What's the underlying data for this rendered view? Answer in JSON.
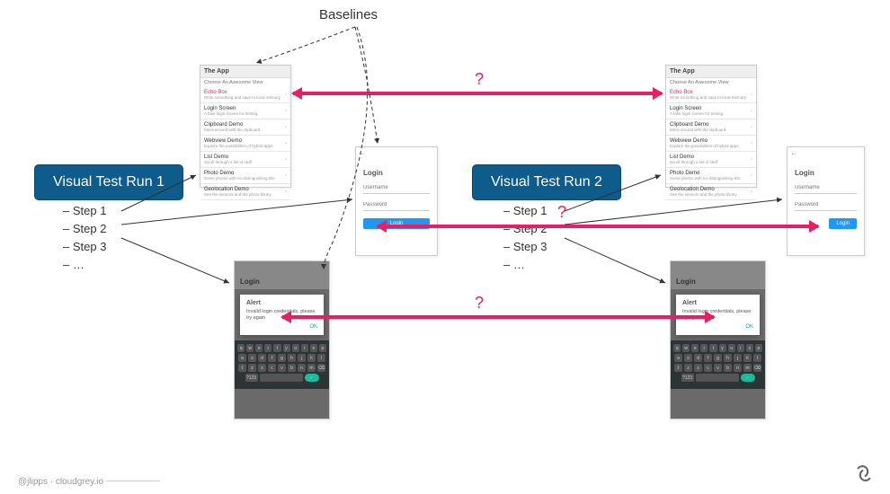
{
  "labels": {
    "baselines": "Baselines"
  },
  "runs": {
    "run1": {
      "title": "Visual Test Run 1",
      "steps": [
        "Step 1",
        "Step 2",
        "Step 3",
        "…"
      ]
    },
    "run2": {
      "title": "Visual Test Run 2",
      "steps": [
        "Step 1",
        "Step 2",
        "Step 3",
        "…"
      ]
    }
  },
  "list_screen": {
    "title": "The App",
    "subtitle": "Choose An Awesome View",
    "items": [
      {
        "title": "Echo Box",
        "desc": "Write something and save to local memory"
      },
      {
        "title": "Login Screen",
        "desc": "A fake login screen for testing"
      },
      {
        "title": "Clipboard Demo",
        "desc": "Mess around with the clipboard"
      },
      {
        "title": "Webview Demo",
        "desc": "Explore the possibilities of hybrid apps"
      },
      {
        "title": "List Demo",
        "desc": "Scroll through a list of stuff"
      },
      {
        "title": "Photo Demo",
        "desc": "Some photos with no distinguishing IDs"
      },
      {
        "title": "Geolocation Demo",
        "desc": "See the sensors and the photo library"
      }
    ]
  },
  "login_screen": {
    "title": "Login",
    "username_ph": "Username",
    "password_ph": "Password",
    "button": "Login"
  },
  "alert_screen": {
    "title": "Login",
    "alert_title": "Alert",
    "alert_msg": "Invalid login credentials, please try again",
    "ok": "OK"
  },
  "keyboard": {
    "row1": [
      "q",
      "w",
      "e",
      "r",
      "t",
      "y",
      "u",
      "i",
      "o",
      "p"
    ],
    "row2": [
      "a",
      "s",
      "d",
      "f",
      "g",
      "h",
      "j",
      "k",
      "l"
    ],
    "row3": [
      "⇧",
      "z",
      "x",
      "c",
      "v",
      "b",
      "n",
      "m",
      "⌫"
    ]
  },
  "questions": {
    "q1": "?",
    "q2": "?",
    "q3": "?"
  },
  "footer": {
    "left": "@jlipps · cloudgrey.io"
  }
}
